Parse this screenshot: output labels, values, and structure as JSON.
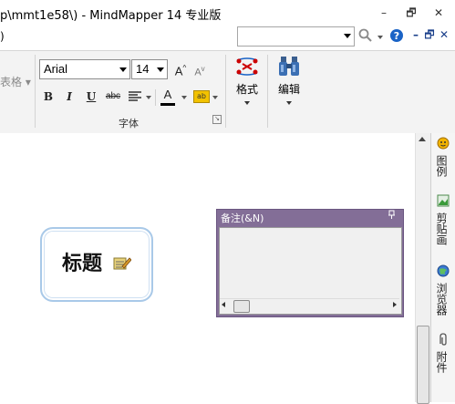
{
  "window": {
    "title": "p\\mmt1e58\\) - MindMapper 14 专业版",
    "minimize": "–",
    "restore": "🗗",
    "close": "✕"
  },
  "menu": {
    "paren": ")",
    "search_value": "",
    "mdi_min": "–",
    "mdi_restore": "🗗",
    "mdi_close": "✕"
  },
  "ribbon": {
    "table_fragment": "表格 ▾",
    "font_name": "Arial",
    "font_size": "14",
    "grow_font": "A",
    "shrink_font": "A",
    "bold": "B",
    "italic": "I",
    "underline": "U",
    "strike": "abc",
    "font_color_letter": "A",
    "highlight": "ab",
    "font_group_label": "字体",
    "launcher": "↘",
    "format_label": "格式",
    "edit_label": "编辑",
    "colors": {
      "font_color": "#000000",
      "highlight": "#f2c200",
      "accent_red": "#cc0000",
      "accent_blue": "#1a63c6"
    }
  },
  "canvas": {
    "topic_title": "标题",
    "topic_icon": "note-edit-icon"
  },
  "notes_panel": {
    "title": "备注(&N)",
    "pin": "ᵖ",
    "content": ""
  },
  "dock": {
    "tabs": [
      {
        "label": "图例",
        "icon": "legend-icon"
      },
      {
        "label": "剪贴画",
        "icon": "clipart-icon"
      },
      {
        "label": "浏览器",
        "icon": "browser-icon"
      },
      {
        "label": "附件",
        "icon": "attachment-icon"
      }
    ]
  }
}
